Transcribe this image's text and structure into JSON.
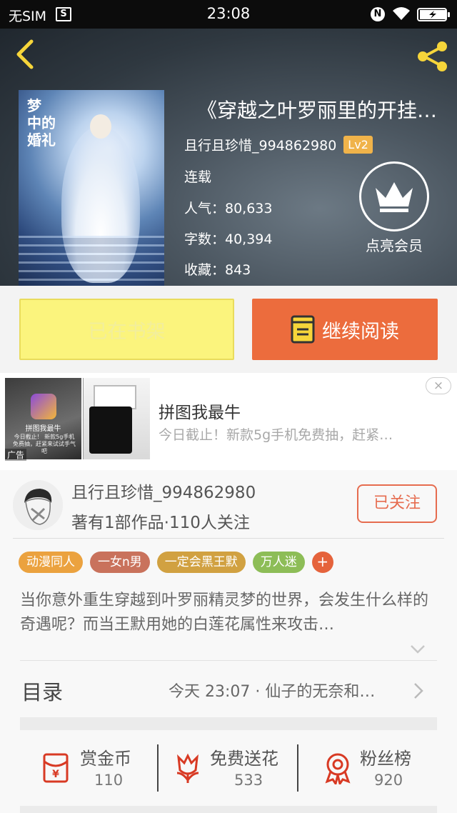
{
  "status_bar": {
    "carrier": "无SIM",
    "time": "23:08"
  },
  "book": {
    "title": "《穿越之叶罗丽里的开挂…",
    "author": "且行且珍惜_994862980",
    "level": "Lv2",
    "status": "连载",
    "popularity": "人气：80,633",
    "word_count": "字数：40,394",
    "favorites": "收藏：843",
    "cover_title": [
      "梦",
      "中的",
      "婚礼"
    ]
  },
  "vip": {
    "label": "点亮会员"
  },
  "buttons": {
    "shelf": "已在书架",
    "continue": "继续阅读"
  },
  "ad": {
    "title": "拼图我最牛",
    "desc": "今日截止！新款5g手机免费抽，赶紧…",
    "tag": "广告",
    "close": "×",
    "image_app_name": "拼图我最牛",
    "image_app_desc": "今日截止！ 新款5g手机免费抽，赶紧来试试手气吧"
  },
  "author_card": {
    "name": "且行且珍惜_994862980",
    "stats": "著有1部作品·110人关注",
    "follow_label": "已关注"
  },
  "tags": [
    {
      "label": "动漫同人",
      "color": "#eba23f"
    },
    {
      "label": "一女n男",
      "color": "#c9725c"
    },
    {
      "label": "一定会黑王默",
      "color": "#d1a141"
    },
    {
      "label": "万人迷",
      "color": "#8dbd57"
    }
  ],
  "tag_add": "+",
  "synopsis": "当你意外重生穿越到叶罗丽精灵梦的世界，会发生什么样的奇遇呢？而当王默用她的白莲花属性来攻击…",
  "toc": {
    "label": "目录",
    "latest": "今天 23:07 · 仙子的无奈和…"
  },
  "stats": {
    "reward": {
      "label": "赏金币",
      "value": "110",
      "icon": "red-envelope-icon"
    },
    "flowers": {
      "label": "免费送花",
      "value": "533",
      "icon": "flower-icon"
    },
    "fans": {
      "label": "粉丝榜",
      "value": "920",
      "icon": "medal-icon"
    }
  },
  "colors": {
    "accent_orange": "#ec6c3d",
    "shelf_yellow": "#fbf47d",
    "icon_red": "#d83a24"
  }
}
